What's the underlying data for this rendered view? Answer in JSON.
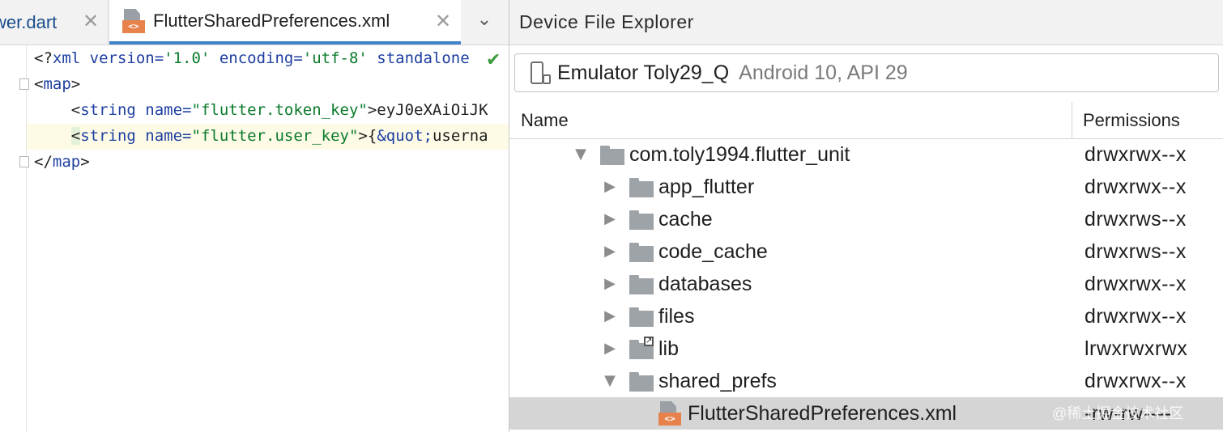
{
  "editor": {
    "tabs": [
      {
        "label": "wer.dart",
        "close": "✕"
      },
      {
        "label": "FlutterSharedPreferences.xml",
        "close": "✕",
        "icon": "xml-file-icon",
        "active": true
      }
    ],
    "overflow_chevron": "⌄",
    "file_tag": "<>",
    "lines": {
      "l1": {
        "decl_open": "<?",
        "xml": "xml",
        "version_attr": " version=",
        "version_val": "'1.0'",
        "encoding_attr": " encoding=",
        "encoding_val": "'utf-8'",
        "standalone_attr": " standalone"
      },
      "l2": {
        "open": "<",
        "tag": "map",
        "close": ">"
      },
      "l3": {
        "indent": "    ",
        "open": "<",
        "tag": "string",
        "name_attr": " name=",
        "name_val": "\"flutter.token_key\"",
        "close": ">",
        "text": "eyJ0eXAiOiJK"
      },
      "l4": {
        "indent": "    ",
        "open": "<",
        "tag": "string",
        "name_attr": " name=",
        "name_val": "\"flutter.user_key\"",
        "close": ">",
        "text_open": "{",
        "entity": "&quot;",
        "text_rest": "userna"
      },
      "l5": {
        "open": "</",
        "tag": "map",
        "close": ">"
      }
    }
  },
  "explorer": {
    "title": "Device File Explorer",
    "device": {
      "name": "Emulator Toly29_Q",
      "detail": "Android 10, API 29",
      "icon": "device-icon"
    },
    "columns": {
      "name": "Name",
      "permissions": "Permissions"
    },
    "rows": [
      {
        "name": "com.toly1994.flutter_unit",
        "perm": "drwxrwx--x",
        "expanded": true,
        "level": 0,
        "kind": "folder"
      },
      {
        "name": "app_flutter",
        "perm": "drwxrwx--x",
        "expanded": false,
        "level": 1,
        "kind": "folder"
      },
      {
        "name": "cache",
        "perm": "drwxrws--x",
        "expanded": false,
        "level": 1,
        "kind": "folder"
      },
      {
        "name": "code_cache",
        "perm": "drwxrws--x",
        "expanded": false,
        "level": 1,
        "kind": "folder"
      },
      {
        "name": "databases",
        "perm": "drwxrwx--x",
        "expanded": false,
        "level": 1,
        "kind": "folder"
      },
      {
        "name": "files",
        "perm": "drwxrwx--x",
        "expanded": false,
        "level": 1,
        "kind": "folder"
      },
      {
        "name": "lib",
        "perm": "lrwxrwxrwx",
        "expanded": false,
        "level": 1,
        "kind": "symlink-folder"
      },
      {
        "name": "shared_prefs",
        "perm": "drwxrwx--x",
        "expanded": true,
        "level": 1,
        "kind": "folder"
      },
      {
        "name": "FlutterSharedPreferences.xml",
        "perm": "-rw-rw----",
        "level": 2,
        "kind": "xml-file",
        "selected": true
      }
    ],
    "watermark": "@稀土掘金技术社区"
  },
  "colors": {
    "accent": "#4083c9",
    "selection": "#d5d5d5",
    "xml_tag": "#e8824c",
    "folder": "#9ea3a8"
  }
}
